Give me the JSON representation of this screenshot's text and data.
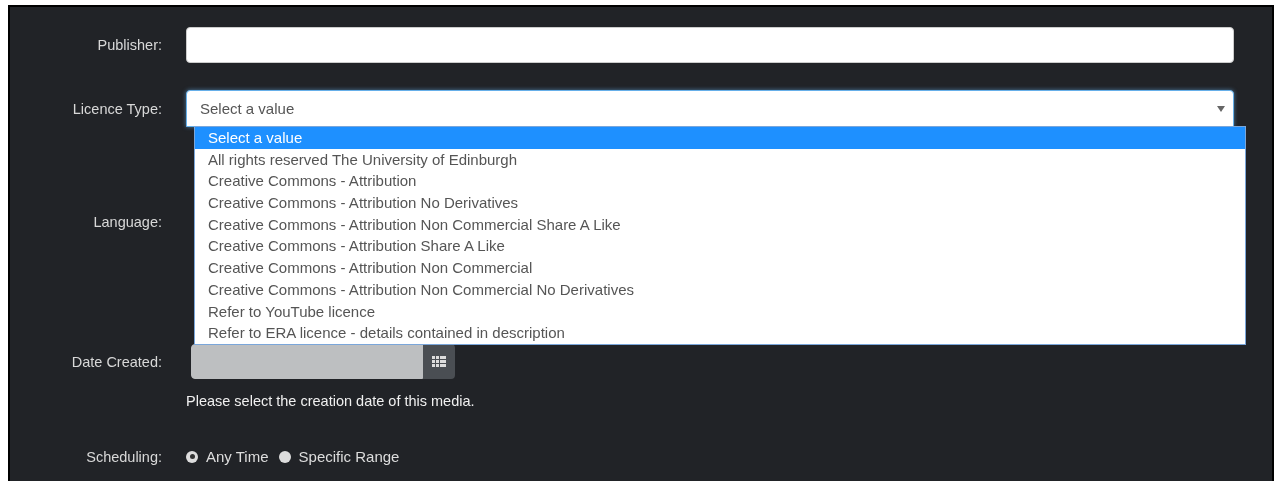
{
  "publisher": {
    "label": "Publisher:"
  },
  "licence_type": {
    "label": "Licence Type:",
    "value": "Select a value",
    "expanded": true,
    "options": [
      {
        "label": "Select a value",
        "selected": true
      },
      {
        "label": "All rights reserved The University of Edinburgh",
        "selected": false
      },
      {
        "label": "Creative Commons - Attribution",
        "selected": false
      },
      {
        "label": "Creative Commons - Attribution No Derivatives",
        "selected": false
      },
      {
        "label": "Creative Commons - Attribution Non Commercial Share A Like",
        "selected": false
      },
      {
        "label": "Creative Commons - Attribution Share A Like",
        "selected": false
      },
      {
        "label": "Creative Commons - Attribution Non Commercial",
        "selected": false
      },
      {
        "label": "Creative Commons - Attribution Non Commercial No Derivatives",
        "selected": false
      },
      {
        "label": "Refer to YouTube licence",
        "selected": false
      },
      {
        "label": "Refer to ERA licence - details contained in description",
        "selected": false
      }
    ]
  },
  "language": {
    "label": "Language:"
  },
  "date_created": {
    "label": "Date Created:",
    "disabled": true,
    "help": "Please select the creation date of this media."
  },
  "scheduling": {
    "label": "Scheduling:",
    "options": [
      {
        "label": "Any Time",
        "selected": true
      },
      {
        "label": "Specific Range",
        "selected": false
      }
    ]
  }
}
